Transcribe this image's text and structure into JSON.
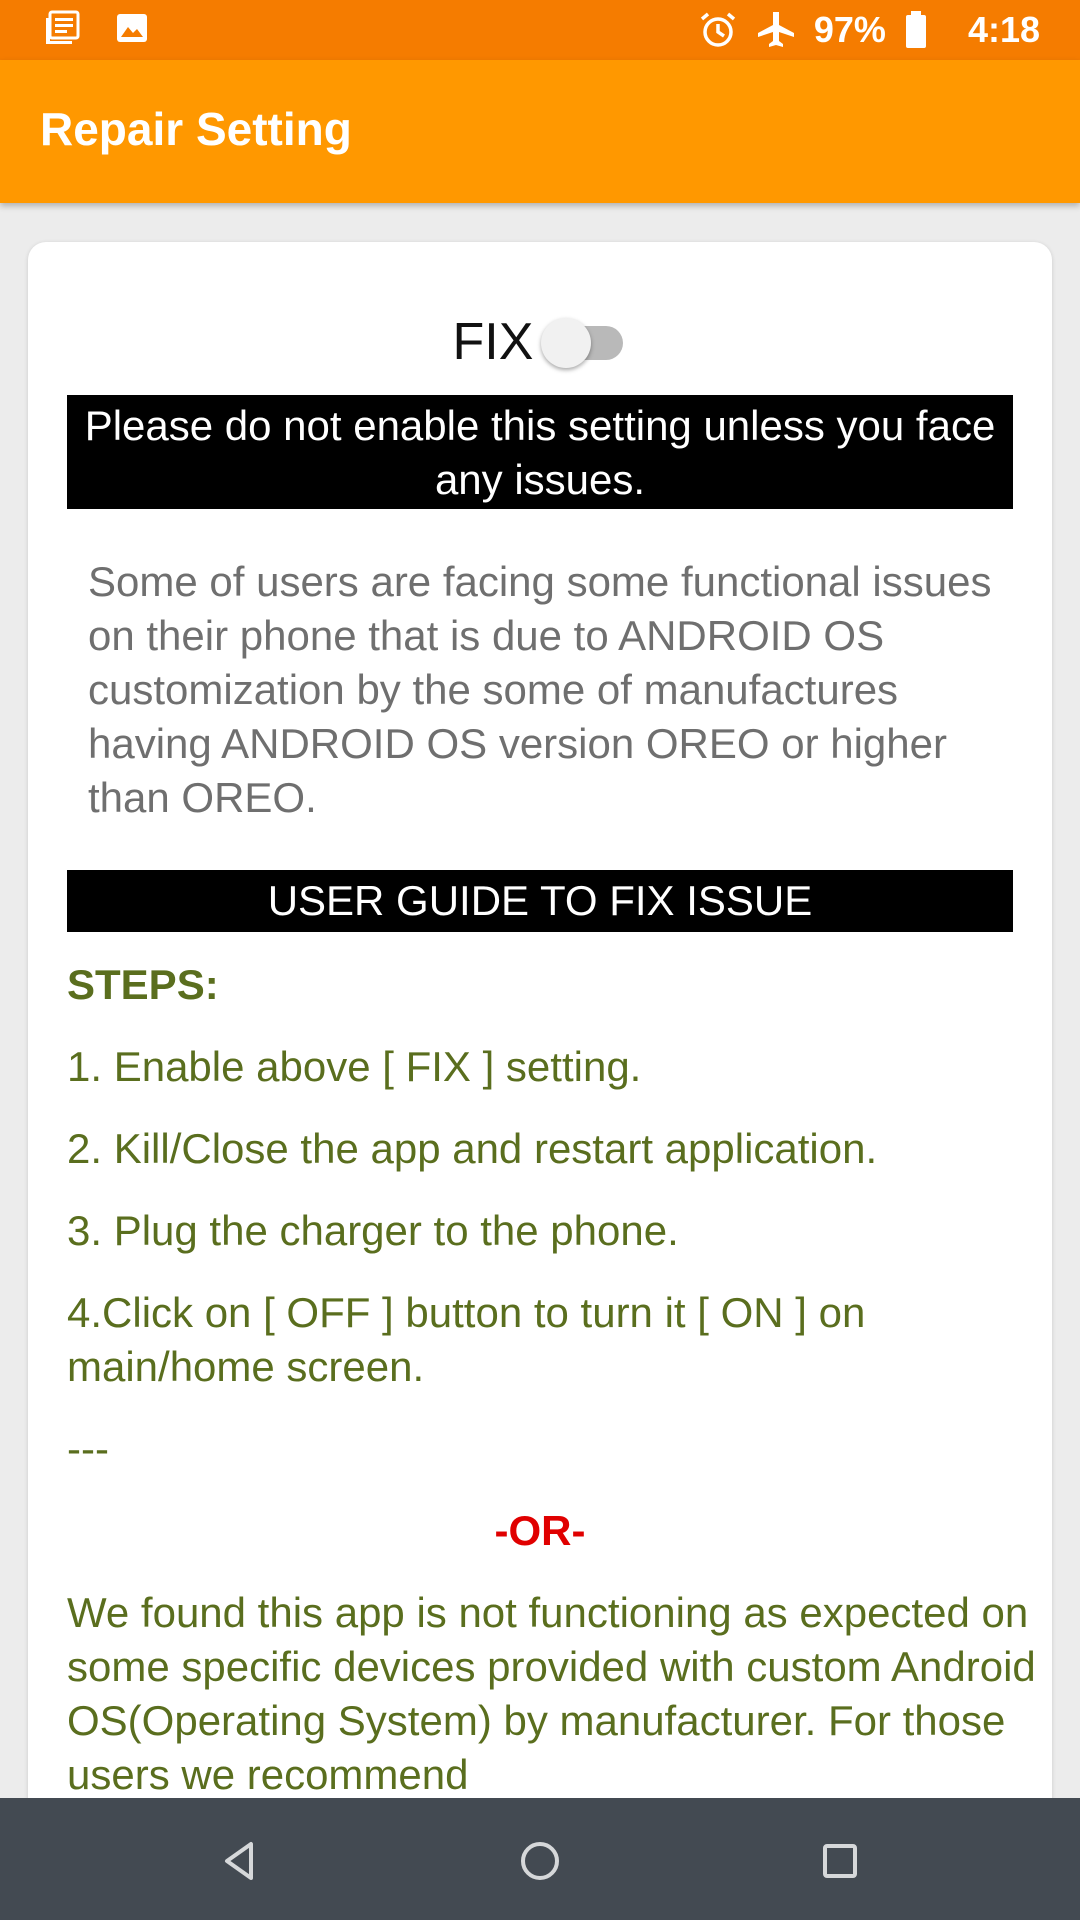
{
  "status_bar": {
    "battery": "97%",
    "time": "4:18",
    "icons": [
      "news-icon",
      "image-icon",
      "alarm-icon",
      "airplane-icon",
      "battery-icon"
    ]
  },
  "app_bar": {
    "title": "Repair Setting"
  },
  "fix_toggle": {
    "label": "FIX",
    "state": "off"
  },
  "warning": "Please do not enable this setting unless you face any issues.",
  "description": "Some of users are facing some functional issues on their phone that is due to ANDROID OS customization by the some of manufactures having ANDROID OS version OREO or higher than OREO.",
  "guide": {
    "header": "USER GUIDE TO FIX ISSUE",
    "steps_title": "STEPS:",
    "steps": [
      "1. Enable above [ FIX ] setting.",
      "2. Kill/Close the app and restart application.",
      "3. Plug the charger to the phone.",
      "4.Click on [ OFF ] button to turn it [ ON ] on main/home screen."
    ],
    "separator": "---",
    "or_label": "-OR-",
    "tail_text": "We found this app is not functioning as expected on some specific devices provided with custom Android OS(Operating System) by manufacturer. For those users we recommend"
  },
  "nav_bar": {
    "icons": [
      "back-icon",
      "home-icon",
      "recents-icon"
    ]
  },
  "colors": {
    "status_bar": "#f57c00",
    "app_bar": "#ff9800",
    "step_text": "#5a6e1e",
    "or_text": "#e00000",
    "nav_bar": "#434a52"
  }
}
